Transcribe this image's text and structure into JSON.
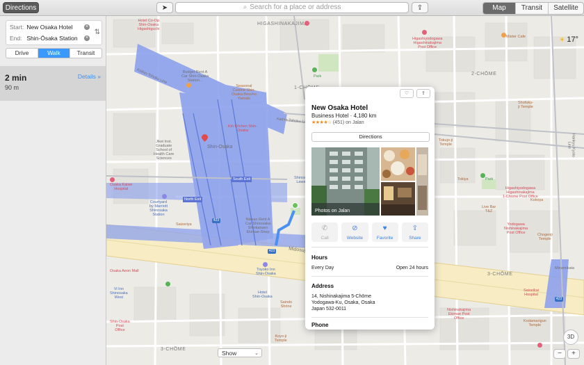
{
  "toolbar": {
    "directions_label": "Directions",
    "search_placeholder": "Search for a place or address",
    "map_types": [
      "Map",
      "Transit",
      "Satellite"
    ],
    "active_map_type": "Map"
  },
  "sidebar": {
    "start_label": "Start:",
    "start_value": "New Osaka Hotel",
    "end_label": "End:",
    "end_value": "Shin-Ōsaka Station",
    "modes": [
      "Drive",
      "Walk",
      "Transit"
    ],
    "active_mode": "Walk",
    "route_time": "2 min",
    "route_distance": "90 m",
    "details_label": "Details »"
  },
  "map": {
    "weather_temp": "17°",
    "show_label": "Show",
    "button_3d": "3D",
    "zoom_out": "−",
    "zoom_in": "+",
    "area_labels": [
      "HIGASHINAKAJIMA",
      "1-CHŌME",
      "2-CHŌME",
      "3-CHŌME",
      "3-CHŌME"
    ],
    "road_labels": [
      "Keihin-Tohoku Line",
      "Keihin-Tohoku Line",
      "Midosuji",
      "Hankyu Kyoto Line"
    ],
    "route_numbers": [
      "423",
      "423",
      "423"
    ],
    "pois": [
      {
        "text": "Hotel Co-Op\nShin-Osaka\nHigashiguchi",
        "color": "red"
      },
      {
        "text": "Budget Rent A\nCar Shin-Osaka\nStation...",
        "color": "gray"
      },
      {
        "text": "Seasonal\nCuisine Shin-\nOsaka Bessho\nYamato",
        "color": "orange"
      },
      {
        "text": "Shin-Osaka",
        "color": "gray"
      },
      {
        "text": "Kiri Kitchen Shin-\nOsaka",
        "color": "red"
      },
      {
        "text": "Jikei Inst.\nGraduate\nSchool of\nHealth Care\nSciences",
        "color": "gray"
      },
      {
        "text": "Osaka Kaisei\nHospital",
        "color": "red"
      },
      {
        "text": "Courtyard\nby Marriott\nShinosaka\nStation",
        "color": "blue"
      },
      {
        "text": "South Exit",
        "color": "gray"
      },
      {
        "text": "North Exit",
        "color": "gray"
      },
      {
        "text": "Nissan Rent A\nCar Shinosaka\nShinkansen\nEkimae-Shop",
        "color": "gray"
      },
      {
        "text": "Toyoko Inn\nShin-Osaka",
        "color": "blue"
      },
      {
        "text": "Saizeriya",
        "color": "orange"
      },
      {
        "text": "Shinosaka\nLawson",
        "color": "blue"
      },
      {
        "text": "Higashiyodogawa\nHigashinakajima\nPost Office",
        "color": "red"
      },
      {
        "text": "Mister Cafe",
        "color": "orange"
      },
      {
        "text": "Park",
        "color": "green"
      },
      {
        "text": "Shofuku-\nji Temple",
        "color": "orange"
      },
      {
        "text": "Tokujo-ji\nTemple",
        "color": "orange"
      },
      {
        "text": "Tokiya",
        "color": "orange"
      },
      {
        "text": "Park",
        "color": "green"
      },
      {
        "text": "Higashiyodogawa\nHigashinakajima\n1-Chome Post Office",
        "color": "red"
      },
      {
        "text": "Kokoya",
        "color": "orange"
      },
      {
        "text": "Live Bar\nT&Z",
        "color": "orange"
      },
      {
        "text": "Yodogawa\nNishinakajima\nPost Office",
        "color": "red"
      },
      {
        "text": "Chogenji\nTemple",
        "color": "orange"
      },
      {
        "text": "Minamikata",
        "color": "gray"
      },
      {
        "text": "Saiseikai\nHospital",
        "color": "red"
      },
      {
        "text": "Nishinakajima\nEkimae Post\nOffice",
        "color": "red"
      },
      {
        "text": "Kodamarigun\nTemple",
        "color": "orange"
      },
      {
        "text": "Osaka Aeon Mall",
        "color": "red"
      },
      {
        "text": "Vi Inn\nShinosaka\nWest",
        "color": "blue"
      },
      {
        "text": "Hotel\nShin-Osaka",
        "color": "blue"
      },
      {
        "text": "Saindo\nShrine",
        "color": "orange"
      },
      {
        "text": "Koyo-ji\nTemple",
        "color": "orange"
      },
      {
        "text": "Shin-Osaka\nPost\nOffice",
        "color": "red"
      }
    ]
  },
  "place": {
    "name": "New Osaka Hotel",
    "subtitle": "Business Hotel · 4,180 km",
    "stars": "★★★★☆",
    "reviews": "(451) on Jalan",
    "directions_label": "Directions",
    "photos_caption": "Photos on Jalan",
    "actions": [
      {
        "label": "Call",
        "icon": "phone-icon",
        "enabled": false
      },
      {
        "label": "Website",
        "icon": "compass-icon",
        "enabled": true
      },
      {
        "label": "Favorite",
        "icon": "heart-icon",
        "enabled": true
      },
      {
        "label": "Share",
        "icon": "share-icon",
        "enabled": true
      }
    ],
    "hours_title": "Hours",
    "hours_day": "Every Day",
    "hours_value": "Open 24 hours",
    "address_title": "Address",
    "address_lines": [
      "14, Nishinakajima 5-Chōme",
      "Yodogawa-Ku, Osaka, Osaka",
      "Japan 532-0011"
    ],
    "phone_title": "Phone"
  },
  "colors": {
    "accent": "#3b99fc",
    "rail": "#7f96e3",
    "route": "#4a90f0"
  }
}
